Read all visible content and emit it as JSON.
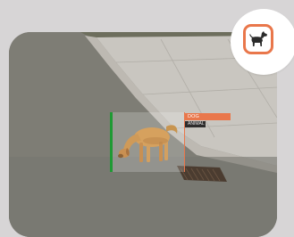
{
  "detection": {
    "primary_label": "DOG",
    "secondary_label": "ANIMAL"
  },
  "badge": {
    "icon": "dog-icon"
  },
  "colors": {
    "accent": "#e9774b",
    "detection_bar": "#1f9a34",
    "secondary_label_bg": "#2e2c2c"
  }
}
